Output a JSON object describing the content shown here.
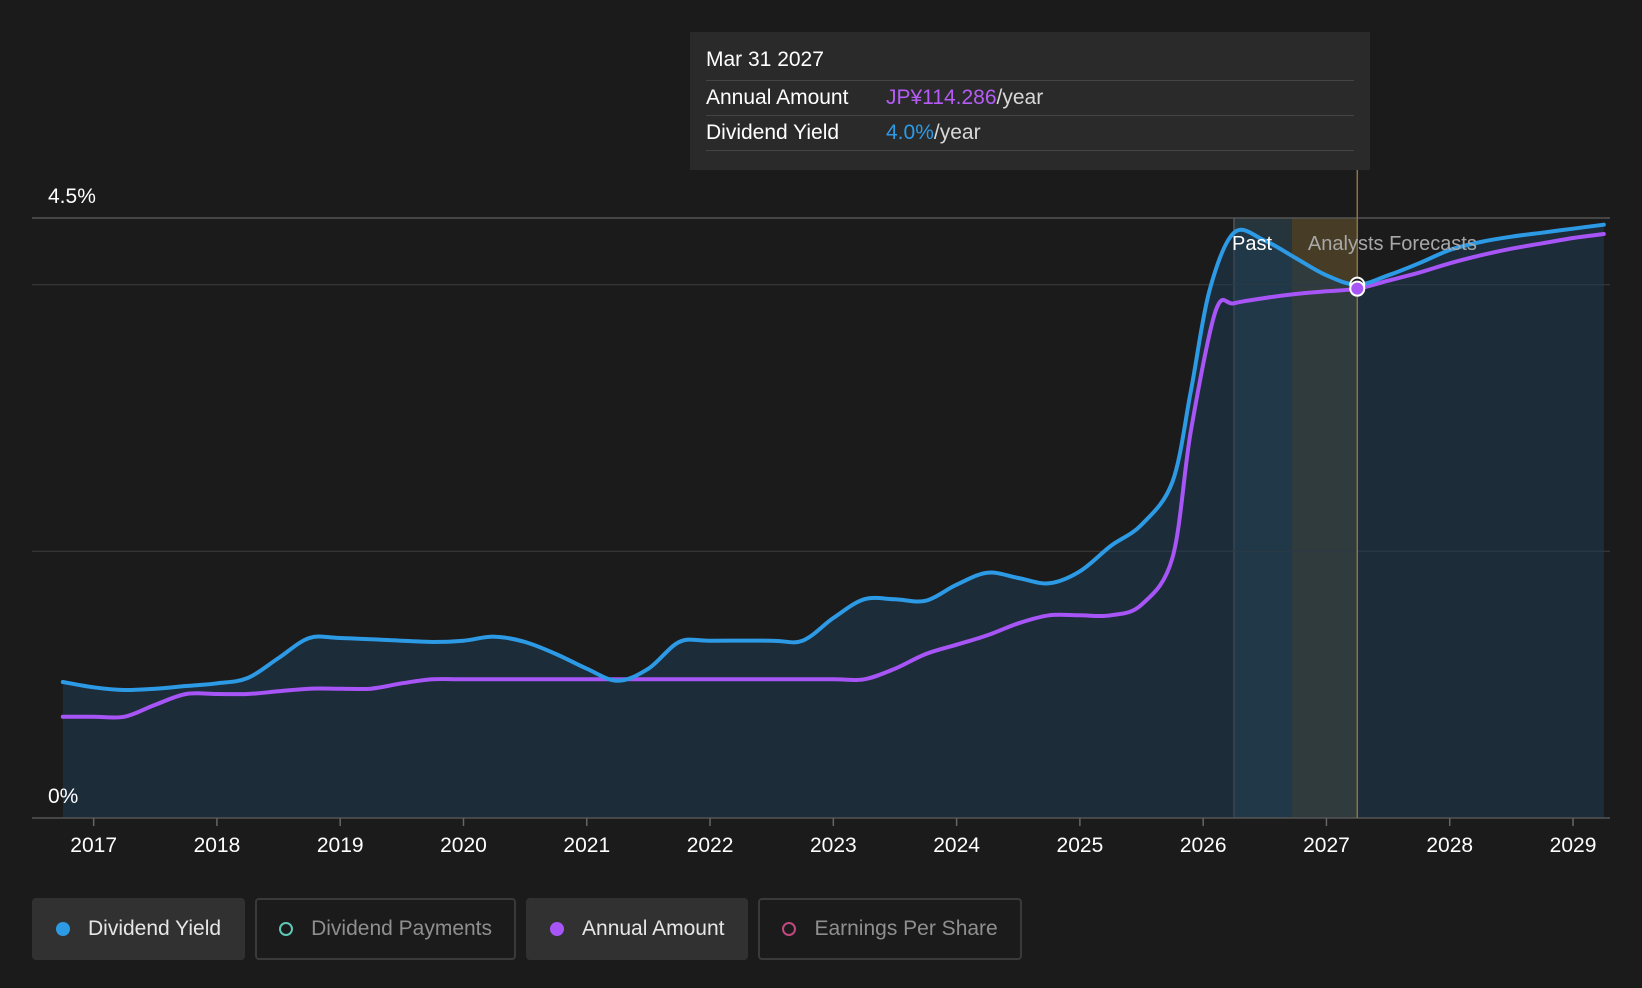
{
  "tooltip": {
    "date": "Mar 31 2027",
    "amount_label": "Annual Amount",
    "amount_value": "JP¥114.286",
    "amount_unit": "/year",
    "yield_label": "Dividend Yield",
    "yield_value": "4.0%",
    "yield_unit": "/year"
  },
  "legend": [
    {
      "label": "Dividend Yield",
      "color": "#2d9ae6",
      "active": true,
      "marker": "filled"
    },
    {
      "label": "Dividend Payments",
      "color": "#5ec8b5",
      "active": false,
      "marker": "hollow"
    },
    {
      "label": "Annual Amount",
      "color": "#a855f7",
      "active": true,
      "marker": "filled"
    },
    {
      "label": "Earnings Per Share",
      "color": "#c1487f",
      "active": false,
      "marker": "hollow"
    }
  ],
  "chart_data": {
    "type": "line",
    "xlim": [
      2016.5,
      2029.3
    ],
    "ylim": [
      0,
      4.5
    ],
    "y_tick_labels": [
      {
        "value": 4.5,
        "label": "4.5%"
      },
      {
        "value": 0,
        "label": "0%"
      }
    ],
    "gridlines": [
      4.0,
      2.0
    ],
    "x_ticks": [
      {
        "value": 2017,
        "label": "2017"
      },
      {
        "value": 2018,
        "label": "2018"
      },
      {
        "value": 2019,
        "label": "2019"
      },
      {
        "value": 2020,
        "label": "2020"
      },
      {
        "value": 2021,
        "label": "2021"
      },
      {
        "value": 2022,
        "label": "2022"
      },
      {
        "value": 2023,
        "label": "2023"
      },
      {
        "value": 2024,
        "label": "2024"
      },
      {
        "value": 2025,
        "label": "2025"
      },
      {
        "value": 2026,
        "label": "2026"
      },
      {
        "value": 2027,
        "label": "2027"
      },
      {
        "value": 2028,
        "label": "2028"
      },
      {
        "value": 2029,
        "label": "2029"
      }
    ],
    "past_label": "Past",
    "forecast_label": "Analysts Forecasts",
    "forecast_start": 2026.25,
    "forecast_band_end": 2026.72,
    "cursor_x": 2027.25,
    "series": [
      {
        "name": "Dividend Yield",
        "color": "#2d9ae6",
        "fill": true,
        "points": [
          [
            2016.75,
            1.02
          ],
          [
            2017.0,
            0.98
          ],
          [
            2017.25,
            0.96
          ],
          [
            2017.5,
            0.97
          ],
          [
            2017.75,
            0.99
          ],
          [
            2018.0,
            1.01
          ],
          [
            2018.25,
            1.05
          ],
          [
            2018.5,
            1.2
          ],
          [
            2018.75,
            1.35
          ],
          [
            2019.0,
            1.35
          ],
          [
            2019.5,
            1.33
          ],
          [
            2019.75,
            1.32
          ],
          [
            2020.0,
            1.33
          ],
          [
            2020.25,
            1.36
          ],
          [
            2020.5,
            1.32
          ],
          [
            2020.75,
            1.23
          ],
          [
            2021.0,
            1.12
          ],
          [
            2021.25,
            1.03
          ],
          [
            2021.5,
            1.12
          ],
          [
            2021.75,
            1.32
          ],
          [
            2022.0,
            1.33
          ],
          [
            2022.5,
            1.33
          ],
          [
            2022.75,
            1.33
          ],
          [
            2023.0,
            1.5
          ],
          [
            2023.25,
            1.64
          ],
          [
            2023.5,
            1.64
          ],
          [
            2023.75,
            1.63
          ],
          [
            2024.0,
            1.75
          ],
          [
            2024.25,
            1.84
          ],
          [
            2024.5,
            1.8
          ],
          [
            2024.75,
            1.76
          ],
          [
            2025.0,
            1.85
          ],
          [
            2025.25,
            2.04
          ],
          [
            2025.5,
            2.2
          ],
          [
            2025.75,
            2.52
          ],
          [
            2025.9,
            3.2
          ],
          [
            2026.05,
            3.95
          ],
          [
            2026.25,
            4.39
          ],
          [
            2026.5,
            4.33
          ],
          [
            2026.75,
            4.2
          ],
          [
            2027.0,
            4.07
          ],
          [
            2027.25,
            4.0
          ],
          [
            2027.5,
            4.07
          ],
          [
            2027.75,
            4.16
          ],
          [
            2028.0,
            4.26
          ],
          [
            2028.25,
            4.32
          ],
          [
            2028.5,
            4.36
          ],
          [
            2028.75,
            4.39
          ],
          [
            2029.0,
            4.42
          ],
          [
            2029.25,
            4.45
          ]
        ]
      },
      {
        "name": "Annual Amount",
        "color": "#a855f7",
        "fill": false,
        "points": [
          [
            2016.75,
            0.76
          ],
          [
            2017.0,
            0.76
          ],
          [
            2017.25,
            0.76
          ],
          [
            2017.5,
            0.85
          ],
          [
            2017.75,
            0.93
          ],
          [
            2018.0,
            0.93
          ],
          [
            2018.25,
            0.93
          ],
          [
            2018.5,
            0.95
          ],
          [
            2018.75,
            0.97
          ],
          [
            2019.0,
            0.97
          ],
          [
            2019.25,
            0.97
          ],
          [
            2019.5,
            1.01
          ],
          [
            2019.75,
            1.04
          ],
          [
            2020.0,
            1.04
          ],
          [
            2020.5,
            1.04
          ],
          [
            2021.0,
            1.04
          ],
          [
            2021.5,
            1.04
          ],
          [
            2022.0,
            1.04
          ],
          [
            2022.5,
            1.04
          ],
          [
            2023.0,
            1.04
          ],
          [
            2023.25,
            1.04
          ],
          [
            2023.5,
            1.12
          ],
          [
            2023.75,
            1.23
          ],
          [
            2024.0,
            1.3
          ],
          [
            2024.25,
            1.37
          ],
          [
            2024.5,
            1.46
          ],
          [
            2024.75,
            1.52
          ],
          [
            2025.0,
            1.52
          ],
          [
            2025.25,
            1.52
          ],
          [
            2025.5,
            1.6
          ],
          [
            2025.75,
            1.95
          ],
          [
            2025.9,
            2.9
          ],
          [
            2026.1,
            3.8
          ],
          [
            2026.25,
            3.86
          ],
          [
            2026.5,
            3.9
          ],
          [
            2026.75,
            3.93
          ],
          [
            2027.0,
            3.95
          ],
          [
            2027.25,
            3.97
          ],
          [
            2027.5,
            4.03
          ],
          [
            2027.75,
            4.09
          ],
          [
            2028.0,
            4.16
          ],
          [
            2028.25,
            4.22
          ],
          [
            2028.5,
            4.27
          ],
          [
            2028.75,
            4.31
          ],
          [
            2029.0,
            4.35
          ],
          [
            2029.25,
            4.38
          ]
        ]
      }
    ]
  }
}
